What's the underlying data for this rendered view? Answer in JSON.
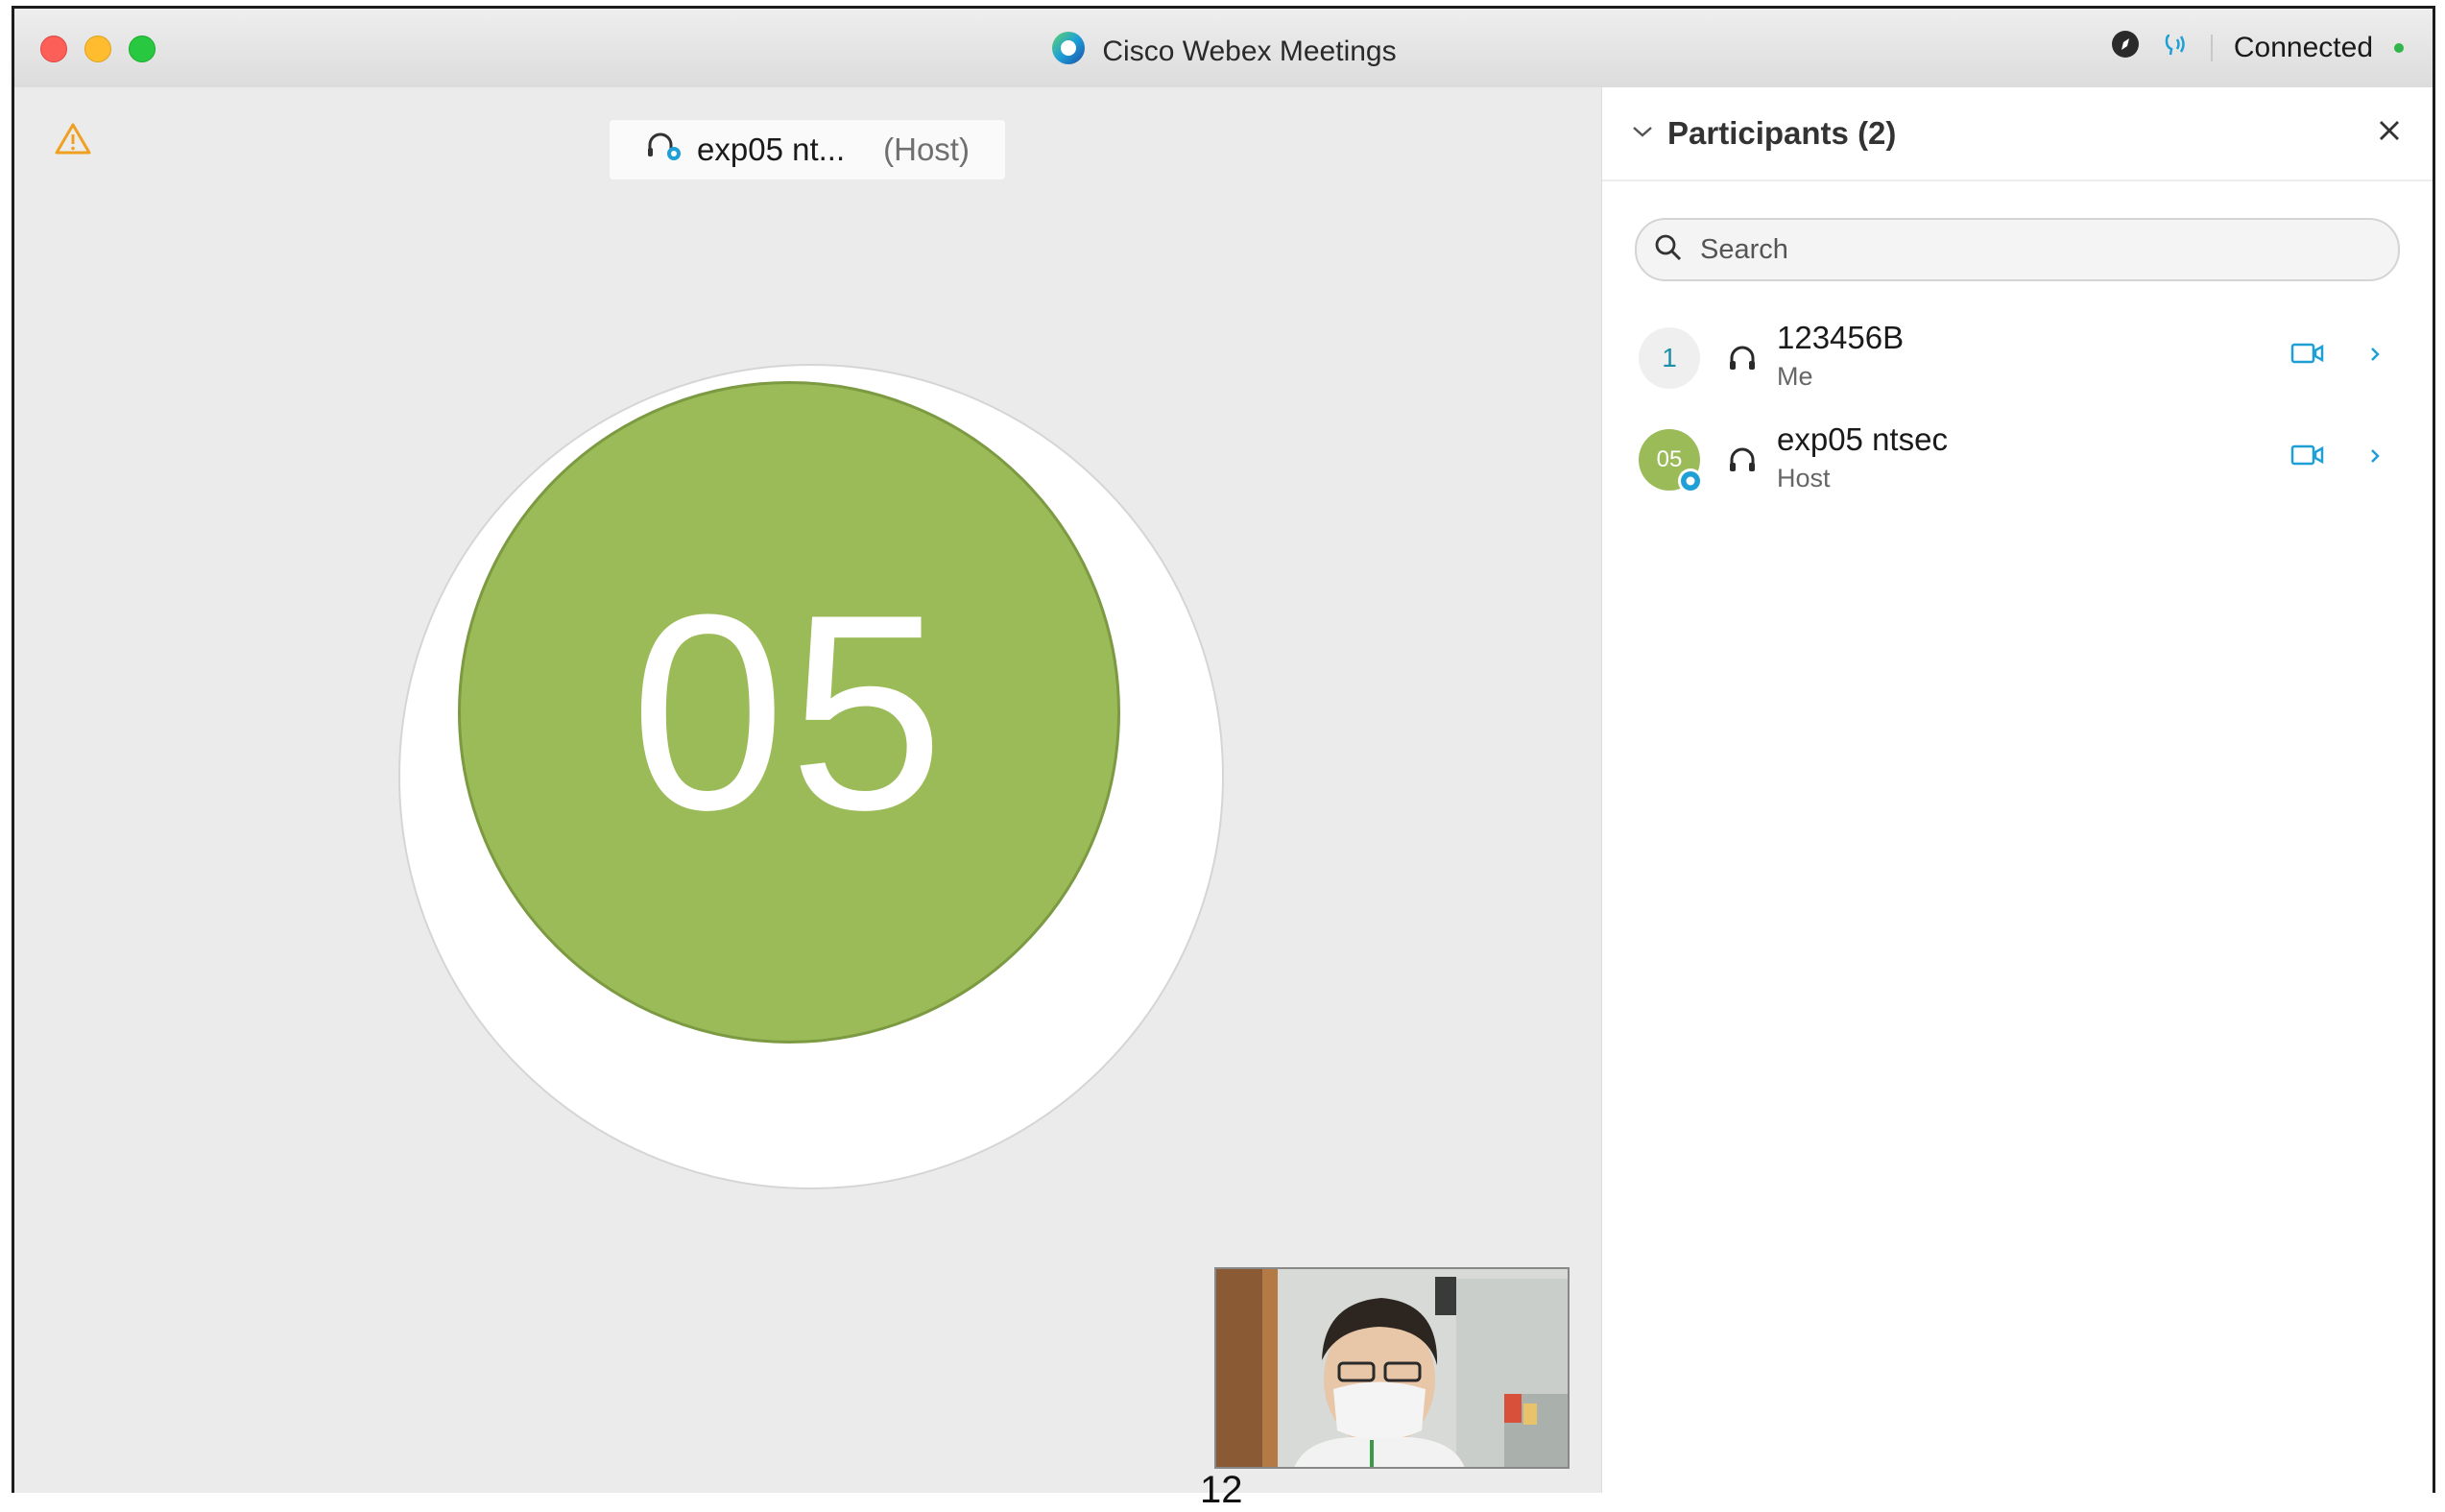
{
  "window": {
    "title": "Cisco Webex Meetings",
    "status": "Connected"
  },
  "stage": {
    "active_speaker_name": "exp05 nt...",
    "active_speaker_role": "(Host)",
    "avatar_initials": "05",
    "page_number": "12"
  },
  "participants_panel": {
    "title": "Participants (2)",
    "search_placeholder": "Search",
    "participants": [
      {
        "avatar": "1",
        "name": "123456B",
        "role": "Me"
      },
      {
        "avatar": "05",
        "name": "exp05 ntsec",
        "role": "Host"
      }
    ]
  },
  "colors": {
    "avatar_green": "#9bbb59",
    "accent_blue": "#1e9fd6",
    "status_green": "#2fb54a",
    "warning_orange": "#f0a020"
  },
  "icons": [
    "webex-logo-icon",
    "compass-icon",
    "audio-indicator-icon",
    "warning-icon",
    "headset-icon",
    "chevron-down-icon",
    "close-icon",
    "search-icon",
    "video-camera-icon",
    "chevron-right-icon"
  ]
}
